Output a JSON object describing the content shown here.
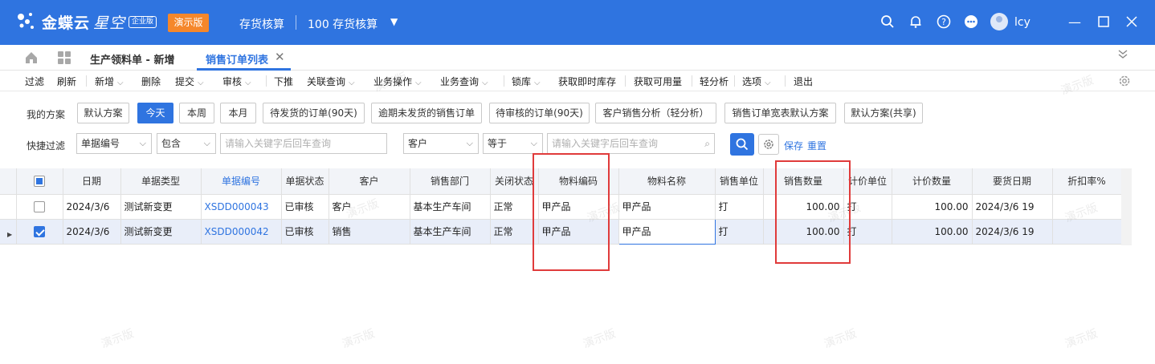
{
  "app": {
    "brand": "金蝶云",
    "brand_sub": "星空",
    "edition": "企业版",
    "demo_badge": "演示版",
    "context_module": "存货核算",
    "context_org": "100 存货核算",
    "user": "lcy"
  },
  "tabs": [
    {
      "label": "生产领料单 - 新增"
    },
    {
      "label": "销售订单列表"
    }
  ],
  "toolbar": {
    "items": [
      "过滤",
      "刷新",
      "新增",
      "删除",
      "提交",
      "审核",
      "下推",
      "关联查询",
      "业务操作",
      "业务查询",
      "锁库",
      "获取即时库存",
      "获取可用量",
      "轻分析",
      "选项",
      "退出"
    ]
  },
  "filters": {
    "scheme_label": "我的方案",
    "schemes": [
      "默认方案",
      "今天",
      "本周",
      "本月",
      "待发货的订单(90天)",
      "逾期未发货的销售订单",
      "待审核的订单(90天)",
      "客户销售分析（轻分析）",
      "销售订单宽表默认方案",
      "默认方案(共享)"
    ],
    "active_scheme": "今天",
    "quick_label": "快捷过滤",
    "field1": "单据编号",
    "op1": "包含",
    "placeholder1": "请输入关键字后回车查询",
    "field2": "客户",
    "op2": "等于",
    "placeholder2": "请输入关键字后回车查询",
    "save_label": "保存",
    "reset_label": "重置"
  },
  "grid": {
    "columns": [
      "日期",
      "单据类型",
      "单据编号",
      "单据状态",
      "客户",
      "销售部门",
      "关闭状态",
      "物料编码",
      "物料名称",
      "销售单位",
      "销售数量",
      "计价单位",
      "计价数量",
      "要货日期",
      "折扣率%"
    ],
    "rows": [
      {
        "date": "2024/3/6",
        "type": "测试新变更",
        "no": "XSDD000043",
        "status": "已审核",
        "customer": "客户",
        "dept": "基本生产车间",
        "close": "正常",
        "mat_code": "甲产品",
        "mat_name": "甲产品",
        "unit": "打",
        "qty": "100.00",
        "price_unit": "打",
        "price_qty": "100.00",
        "req_date": "2024/3/6 19",
        "discount": "",
        "checked": false
      },
      {
        "date": "2024/3/6",
        "type": "测试新变更",
        "no": "XSDD000042",
        "status": "已审核",
        "customer": "销售",
        "dept": "基本生产车间",
        "close": "正常",
        "mat_code": "甲产品",
        "mat_name": "甲产品",
        "unit": "打",
        "qty": "100.00",
        "price_unit": "打",
        "price_qty": "100.00",
        "req_date": "2024/3/6 19",
        "discount": "",
        "checked": true
      }
    ]
  },
  "watermark": "演示版",
  "colors": {
    "primary": "#2f74e0",
    "demo": "#f5872b",
    "annotation": "#e03b3b"
  }
}
